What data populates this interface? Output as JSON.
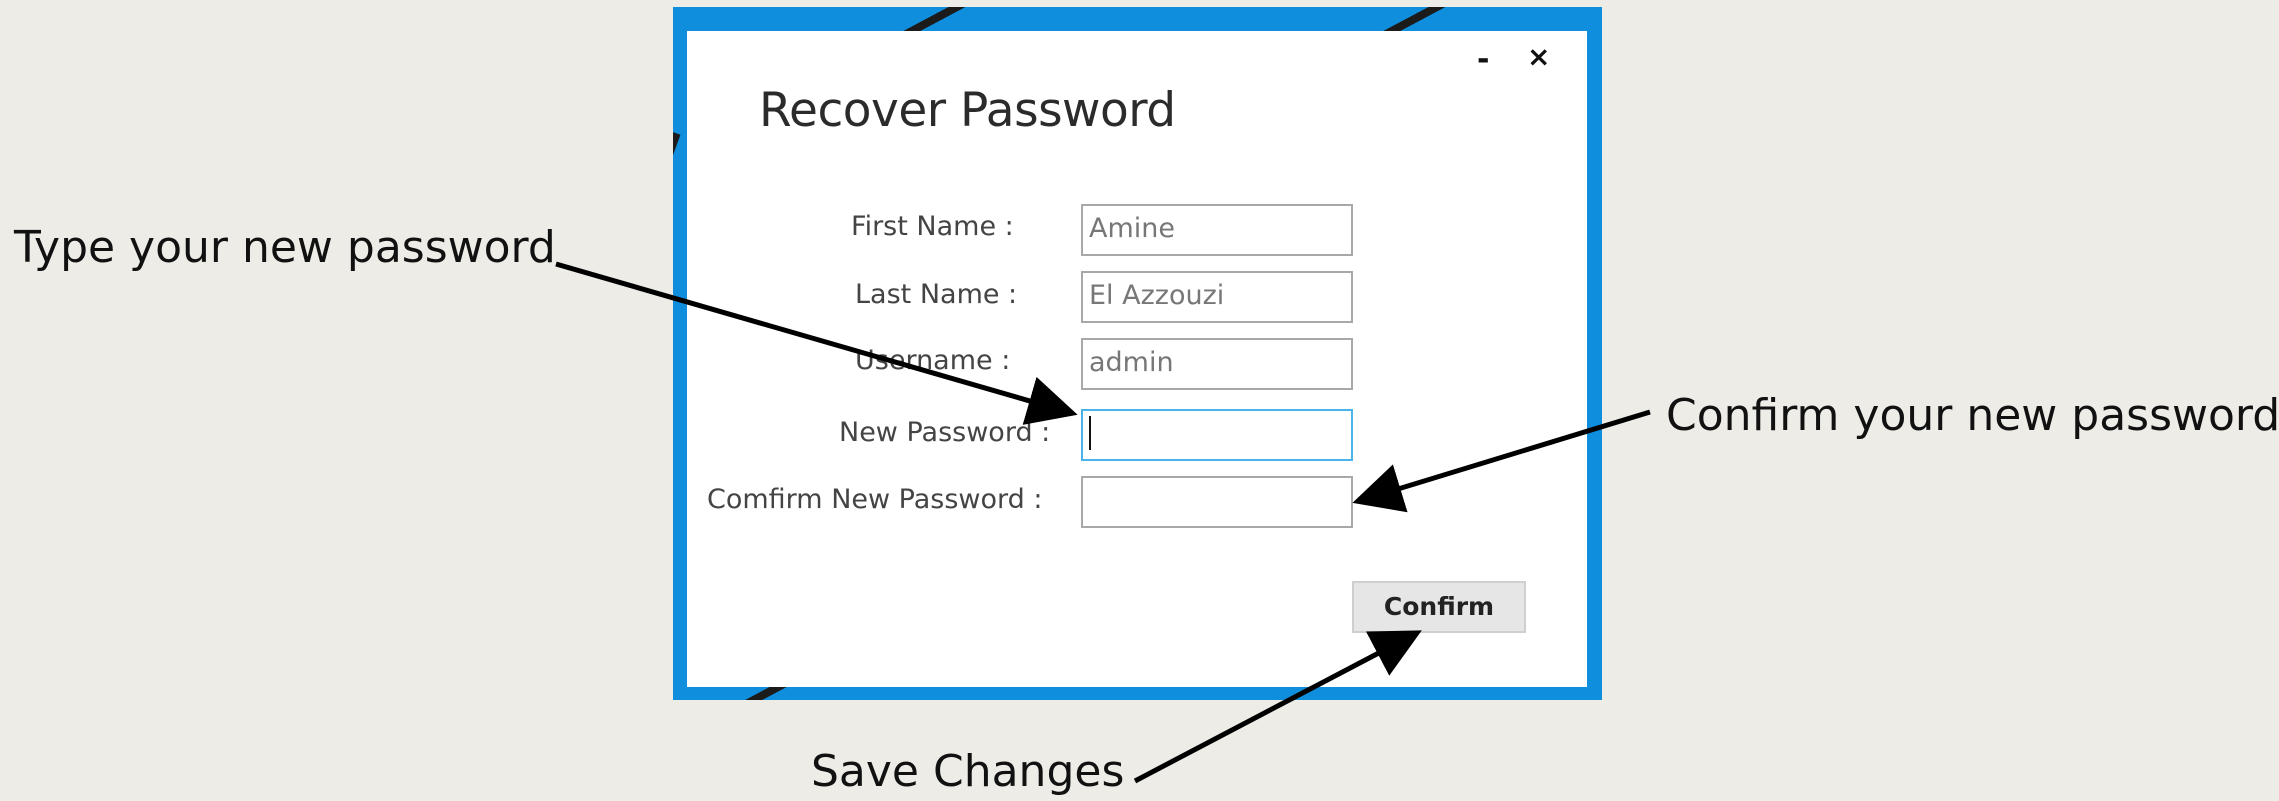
{
  "window": {
    "title": "Recover Password",
    "minimize_symbol": "-",
    "close_symbol": "×",
    "frame_color": "#0f8ede",
    "focus_color": "#4ab3ea"
  },
  "form": {
    "first_name_label": "First Name :",
    "first_name_value": "Amine",
    "last_name_label": "Last Name :",
    "last_name_value": "El Azzouzi",
    "username_label": "Username :",
    "username_value": "admin",
    "new_password_label": "New Password :",
    "new_password_value": "",
    "confirm_password_label": "Comfirm New Password :",
    "confirm_password_value": "",
    "confirm_button_label": "Confirm"
  },
  "annotations": {
    "new_password_note": "Type your new password",
    "confirm_password_note": "Confirm your new password",
    "save_note": "Save Changes"
  }
}
